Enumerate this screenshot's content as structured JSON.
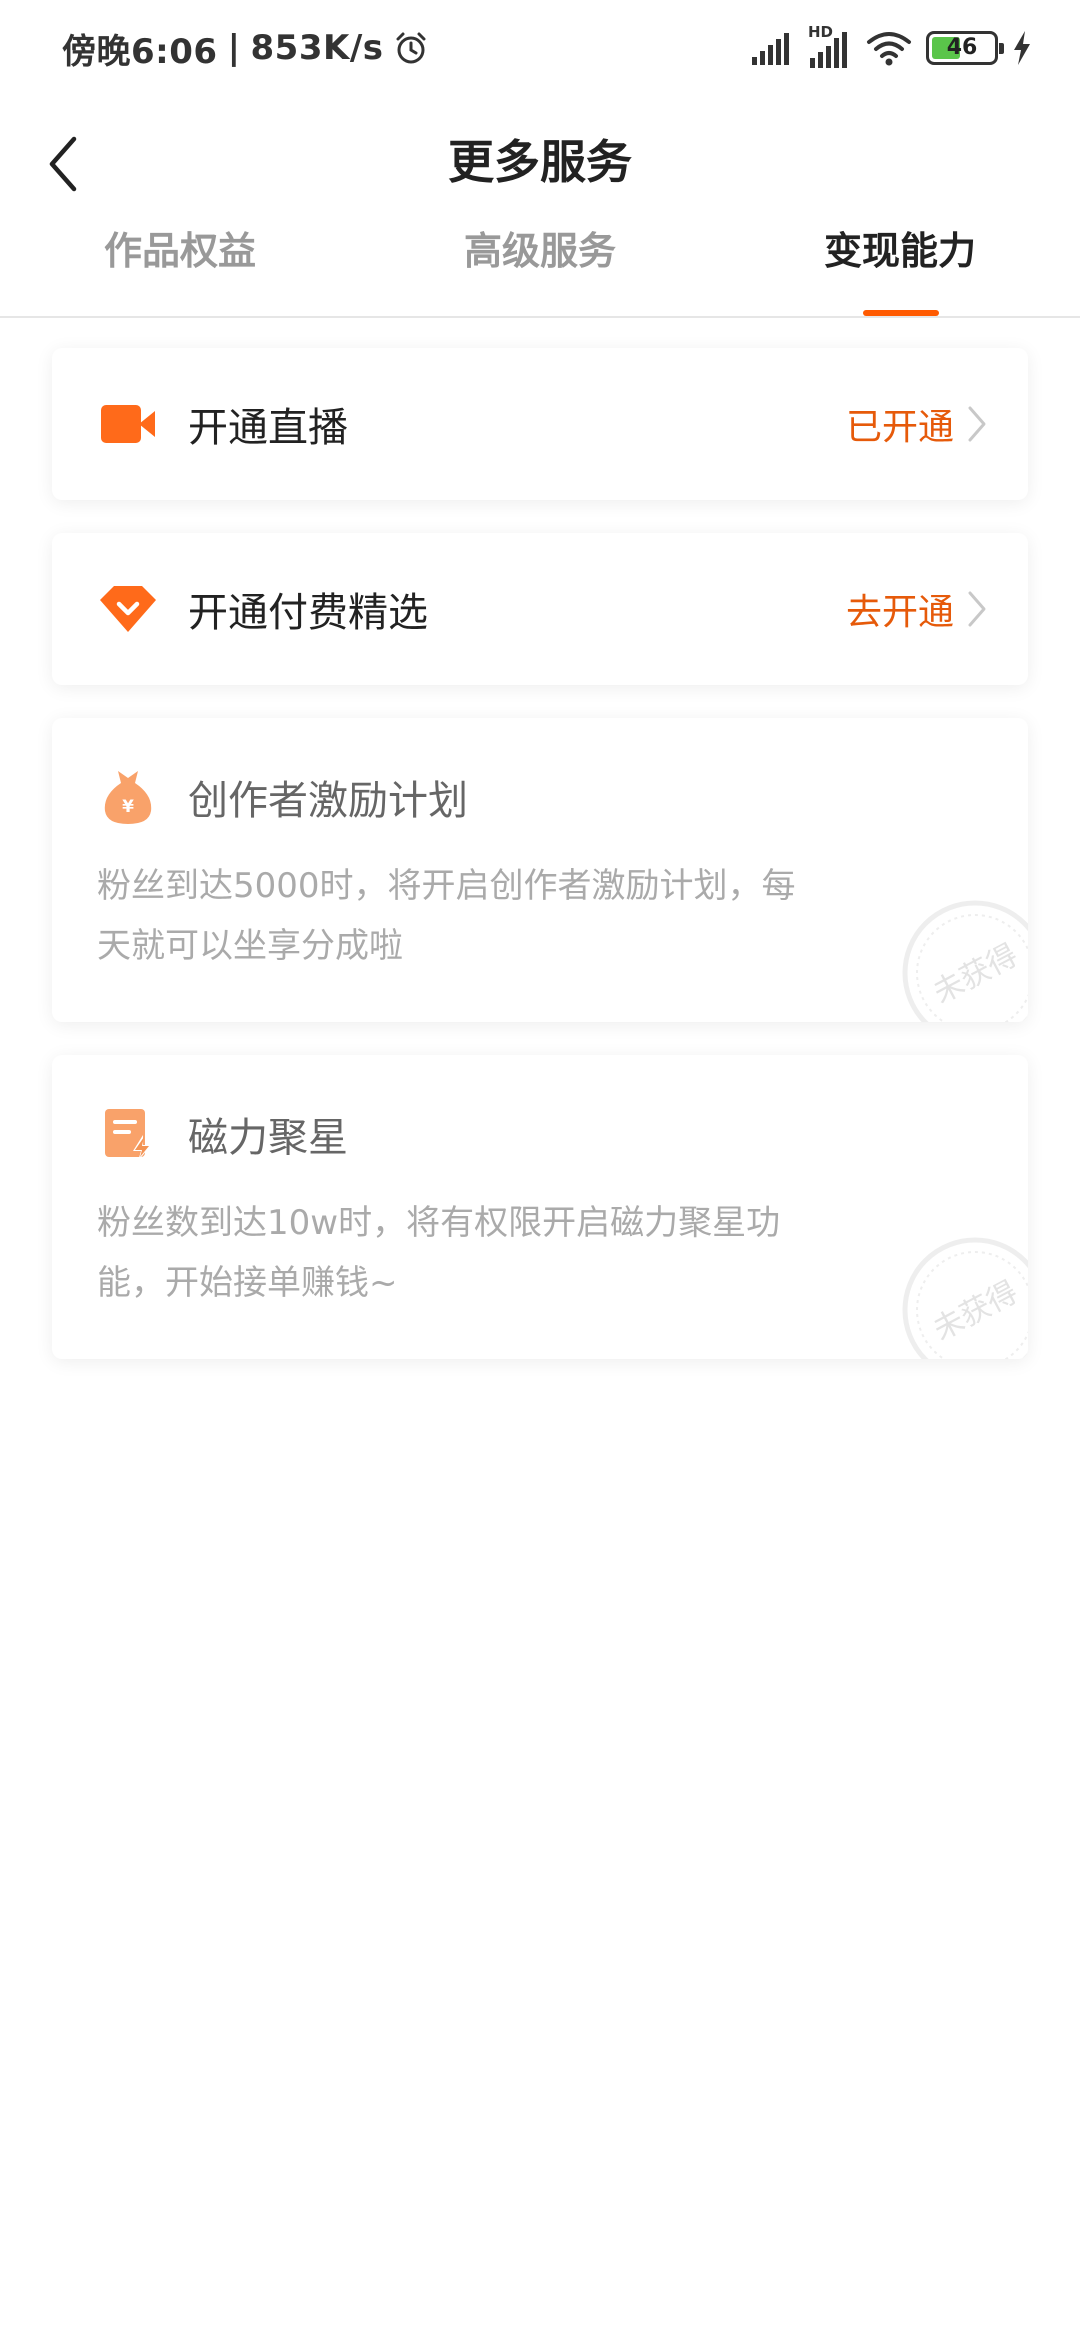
{
  "status_bar": {
    "time": "傍晚6:06",
    "speed": "853K/s",
    "network_label": "HD",
    "battery_level": "46",
    "battery_fraction": 0.46
  },
  "header": {
    "title": "更多服务"
  },
  "tabs": [
    {
      "label": "作品权益",
      "active": false
    },
    {
      "label": "高级服务",
      "active": false
    },
    {
      "label": "变现能力",
      "active": true
    }
  ],
  "cards": [
    {
      "title": "开通直播",
      "status": "已开通"
    },
    {
      "title": "开通付费精选",
      "status": "去开通"
    },
    {
      "title": "创作者激励计划",
      "description": "粉丝到达5000时，将开启创作者激励计划，每天就可以坐享分成啦",
      "stamp": "未获得"
    },
    {
      "title": "磁力聚星",
      "description": "粉丝数到达10w时，将有权限开启磁力聚星功能，开始接单赚钱~",
      "stamp": "未获得"
    }
  ],
  "icons": {
    "alarm": "alarm-clock-icon",
    "signal": "signal-bars-icon",
    "wifi": "wifi-icon",
    "battery": "battery-icon",
    "charging": "lightning-bolt-icon",
    "back": "chevron-left-icon",
    "live": "video-camera-icon",
    "paid": "diamond-icon",
    "incentive": "money-bag-icon",
    "star": "document-lightning-icon",
    "chevron": "chevron-right-icon"
  },
  "colors": {
    "accent": "#ff5a00",
    "status_text": "#e65a0a",
    "icon_orange": "#ff6a1a",
    "icon_light": "#f9a26a",
    "muted_text": "#aaaaaa"
  }
}
